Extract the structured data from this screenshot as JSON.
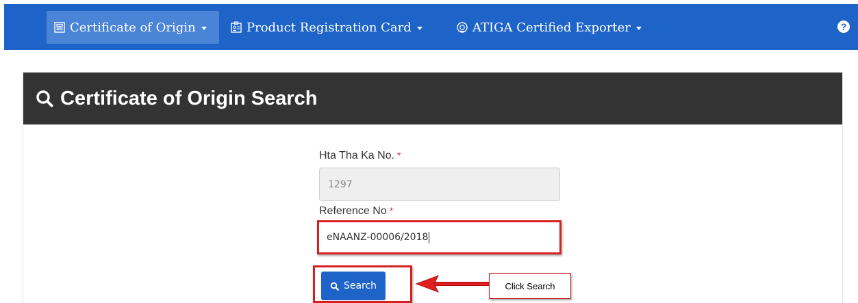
{
  "nav": {
    "items": [
      {
        "label": "Certificate of Origin",
        "icon": "certificate-icon"
      },
      {
        "label": "Product Registration Card",
        "icon": "id-card-icon"
      },
      {
        "label": "ATIGA Certified Exporter",
        "icon": "badge-icon"
      }
    ],
    "help_icon": "question-circle-icon",
    "help_glyph": "?"
  },
  "panel": {
    "title": "Certificate of Origin Search",
    "title_icon": "search-icon"
  },
  "form": {
    "hta_label": "Hta Tha Ka No.",
    "hta_value": "1297",
    "reference_label": "Reference No",
    "reference_value": "eNAANZ-00006/2018",
    "required_mark": "*",
    "search_button": "Search"
  },
  "annotation": {
    "callout_text": "Click Search"
  },
  "colors": {
    "navbar": "#1e64c8",
    "panel_header": "#333333",
    "highlight": "#d62020",
    "button": "#1e64c8"
  }
}
